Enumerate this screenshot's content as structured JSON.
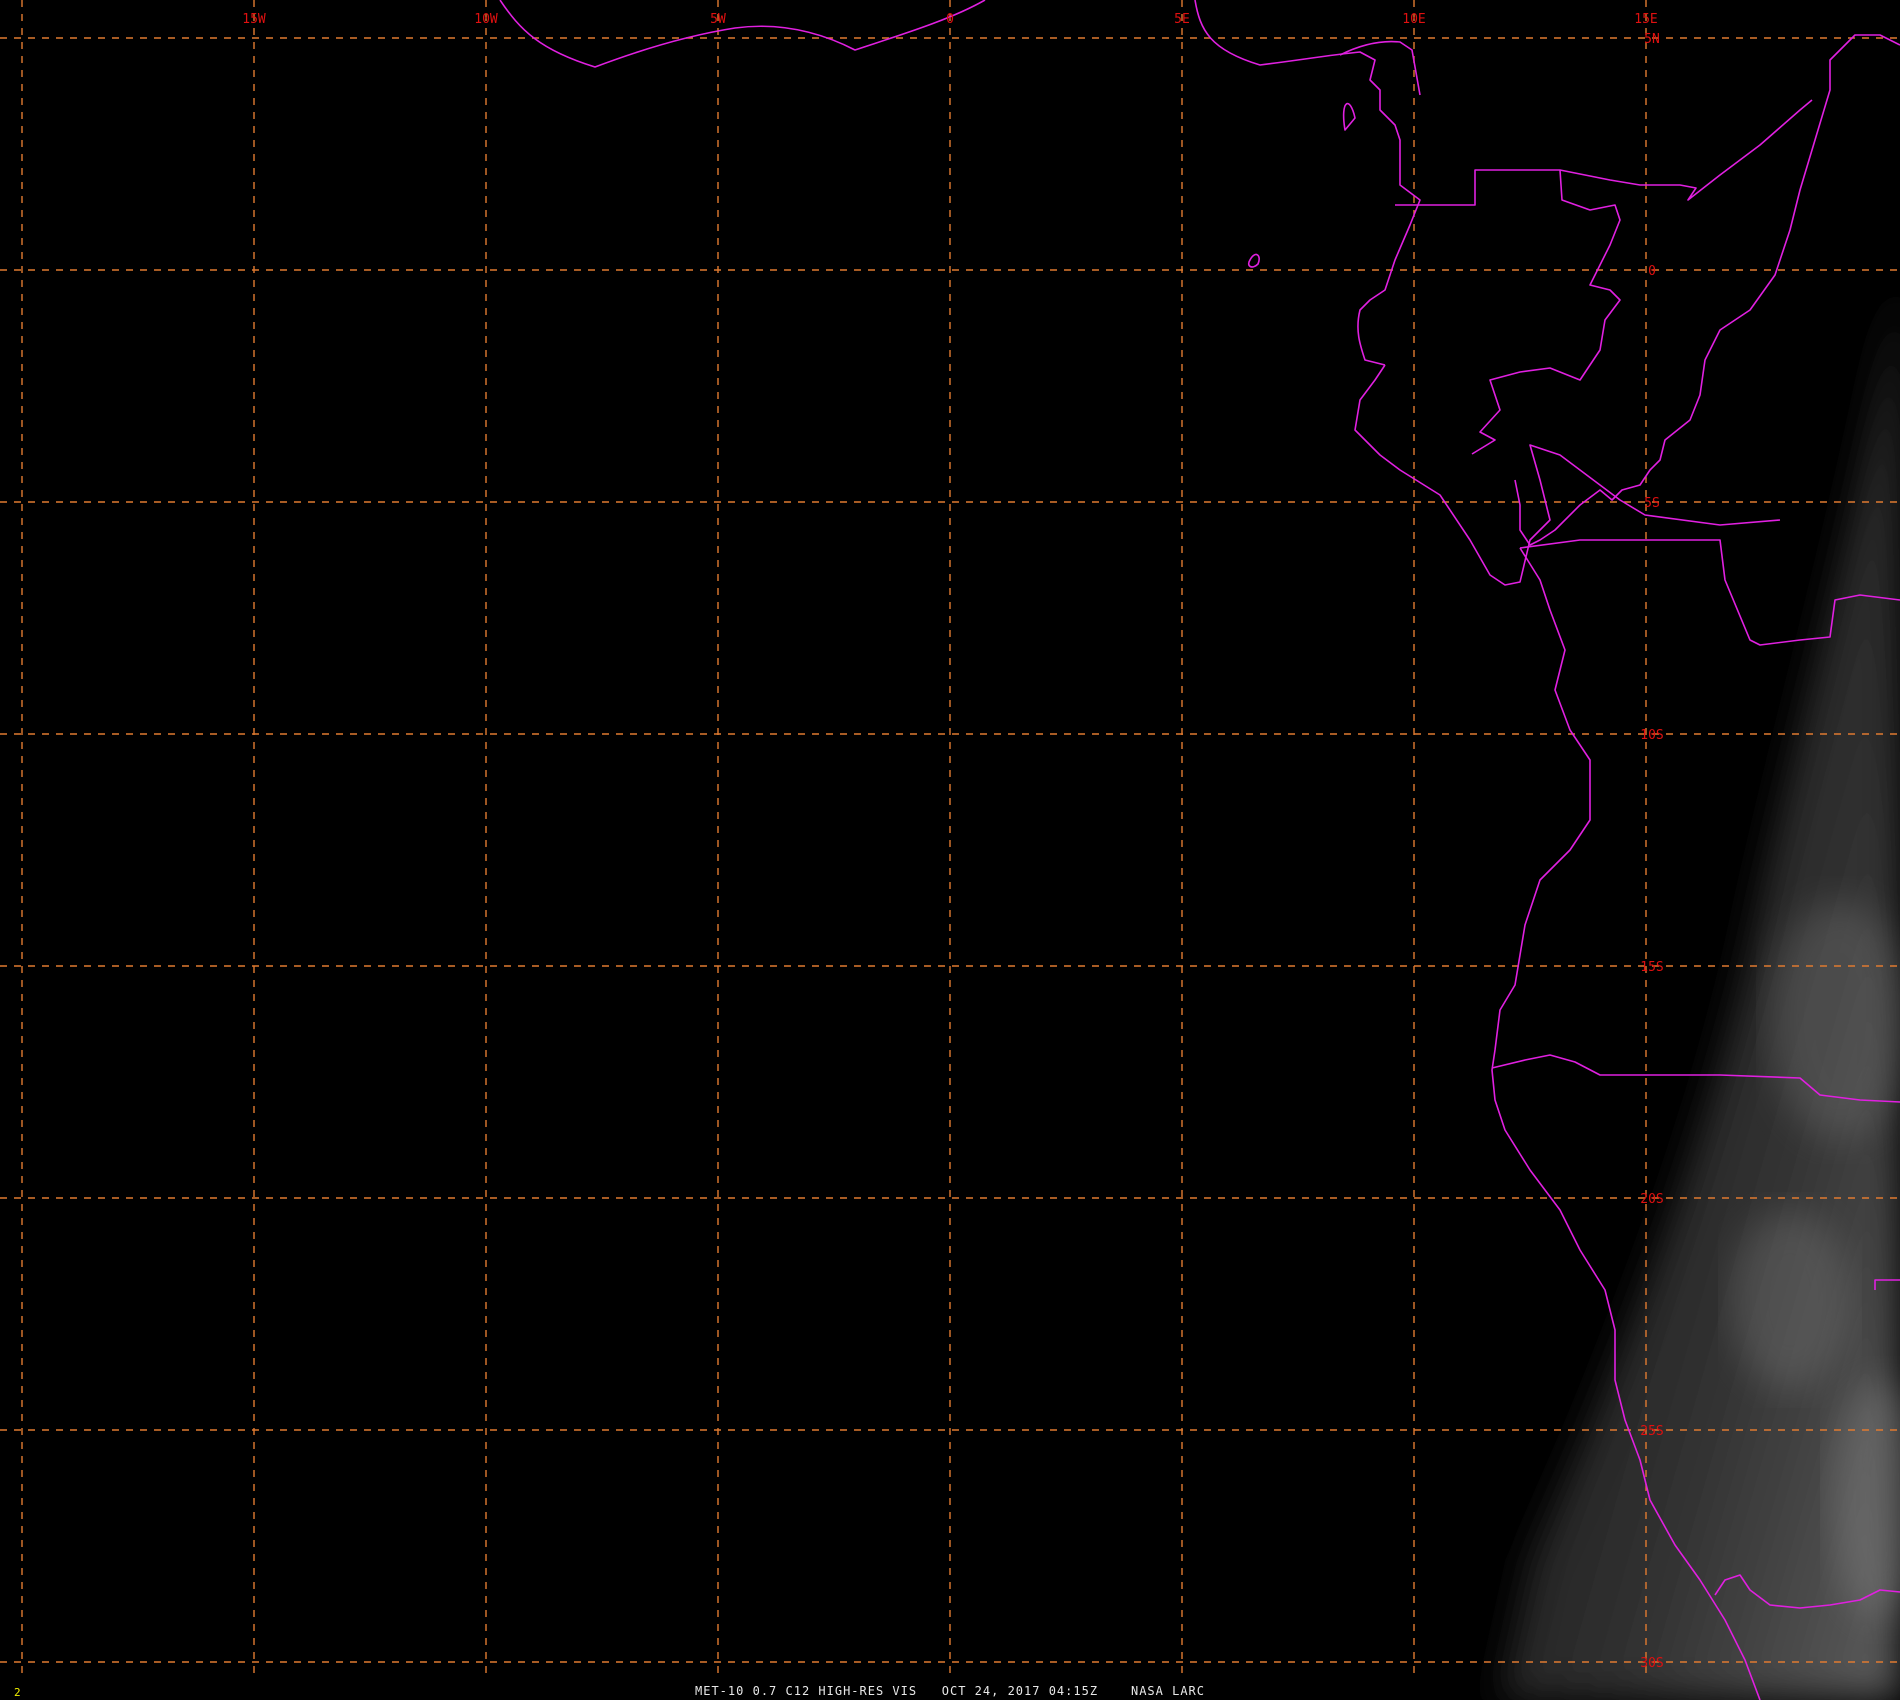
{
  "frame_number": "2",
  "footer": {
    "satellite": "MET-10",
    "channel": "0.7 C12 HIGH-RES VIS",
    "timestamp": "OCT 24, 2017 04:15Z",
    "credit": "NASA LARC"
  },
  "colors": {
    "background": "#000000",
    "gridline": "#e07a30",
    "grid_label": "#e01010",
    "boundary": "#e020e0",
    "footer_text": "#e8e8e8",
    "frame_number": "#f0f000"
  },
  "map": {
    "lon_labels": [
      "15W",
      "10W",
      "5W",
      "0",
      "5E",
      "10E",
      "15E"
    ],
    "lat_labels": [
      "5N",
      "0",
      "5S",
      "10S",
      "15S",
      "20S",
      "25S",
      "30S"
    ],
    "gridline_spacing_deg": 5
  }
}
